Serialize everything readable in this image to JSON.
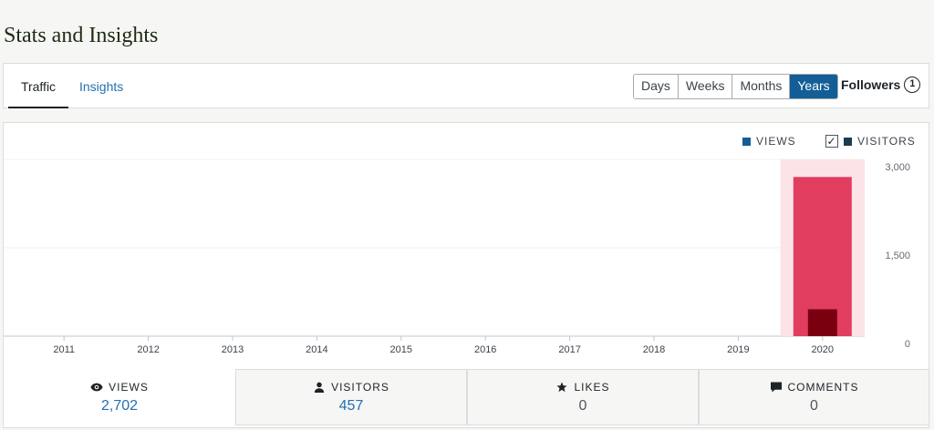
{
  "page_title": "Stats and Insights",
  "tabs": {
    "traffic": "Traffic",
    "insights": "Insights"
  },
  "periods": [
    "Days",
    "Weeks",
    "Months",
    "Years"
  ],
  "active_period": "Years",
  "followers": {
    "label": "Followers",
    "count": "1"
  },
  "legend": {
    "views": "VIEWS",
    "visitors": "VISITORS",
    "visitors_checked": true
  },
  "colors": {
    "views_legend": "#135e96",
    "visitors_legend": "#1d3b4f",
    "views_bar": "#e03d5f",
    "visitors_bar": "#7a0010",
    "highlight": "#fbe3e8",
    "accent": "#135e96"
  },
  "chart_data": {
    "type": "bar",
    "categories": [
      "2011",
      "2012",
      "2013",
      "2014",
      "2015",
      "2016",
      "2017",
      "2018",
      "2019",
      "2020"
    ],
    "series": [
      {
        "name": "VIEWS",
        "values": [
          0,
          0,
          0,
          0,
          0,
          0,
          0,
          0,
          0,
          2702
        ]
      },
      {
        "name": "VISITORS",
        "values": [
          0,
          0,
          0,
          0,
          0,
          0,
          0,
          0,
          0,
          457
        ]
      }
    ],
    "yticks": [
      "3,000",
      "1,500",
      "0"
    ],
    "ylim": [
      0,
      3000
    ],
    "highlighted_category": "2020",
    "grid": true
  },
  "stats": [
    {
      "label": "VIEWS",
      "value": "2,702",
      "icon": "eye-icon"
    },
    {
      "label": "VISITORS",
      "value": "457",
      "icon": "person-icon"
    },
    {
      "label": "LIKES",
      "value": "0",
      "icon": "star-icon"
    },
    {
      "label": "COMMENTS",
      "value": "0",
      "icon": "comment-icon"
    }
  ]
}
